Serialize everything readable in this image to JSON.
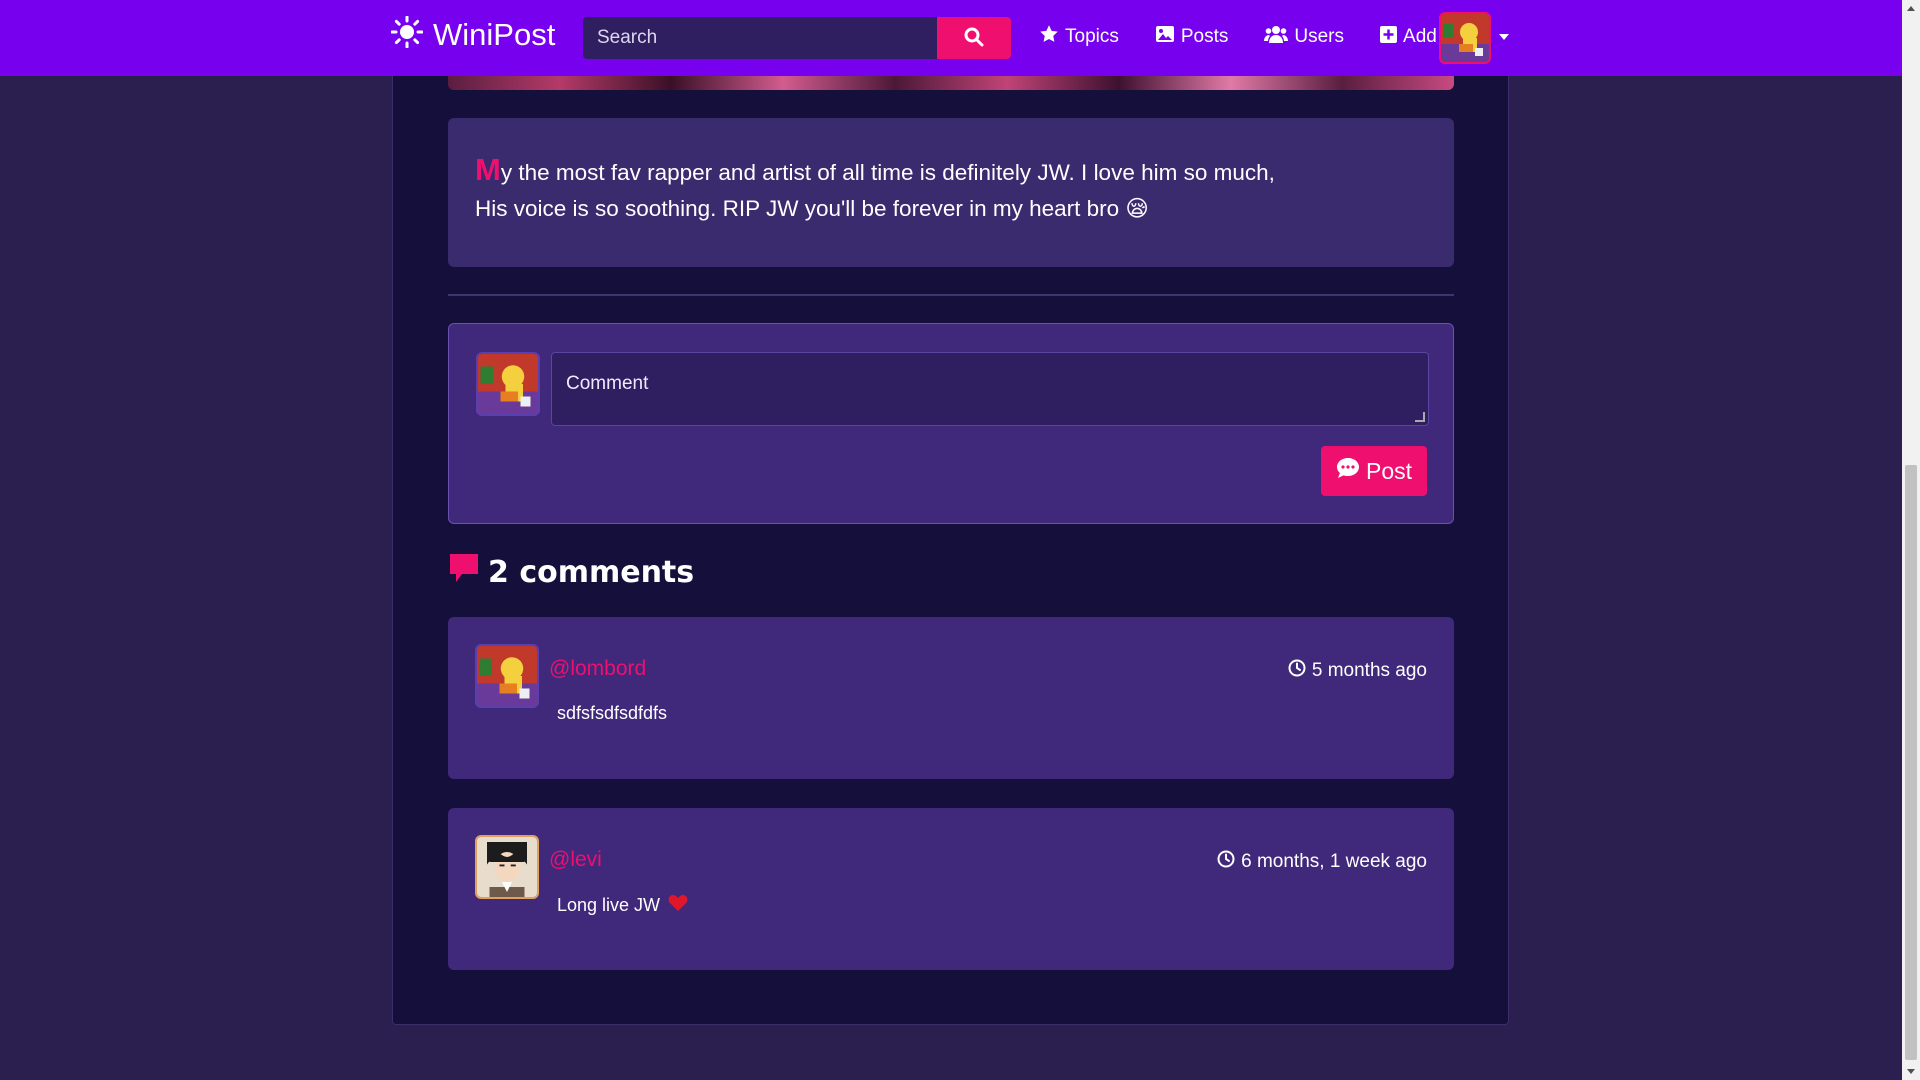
{
  "header": {
    "brand": "WiniPost",
    "search_placeholder": "Search",
    "nav": [
      {
        "label": "Topics",
        "icon": "star-icon"
      },
      {
        "label": "Posts",
        "icon": "image-icon"
      },
      {
        "label": "Users",
        "icon": "users-icon"
      },
      {
        "label": "Add",
        "icon": "plus-square-icon"
      }
    ]
  },
  "post": {
    "body_first_letter": "M",
    "body_line1": "y the most fav rapper and artist of all time is definitely JW. I love him so much,",
    "body_line2": "His voice is so soothing. RIP JW you'll be forever in my heart bro",
    "body_emoji": "😪"
  },
  "comment_form": {
    "placeholder": "Comment",
    "submit_label": "Post"
  },
  "comments": {
    "heading": "2 comments",
    "items": [
      {
        "user": "@lombord",
        "time": "5 months ago",
        "text": "sdfsfsdfsdfdfs"
      },
      {
        "user": "@levi",
        "time": "6 months, 1 week ago",
        "text": "Long live JW"
      }
    ]
  },
  "colors": {
    "navbar": "#7700ee",
    "accent": "#ee0f6e",
    "page_bg": "#2a1f4e",
    "container_bg": "#14103b",
    "card_bg": "#40287a"
  }
}
